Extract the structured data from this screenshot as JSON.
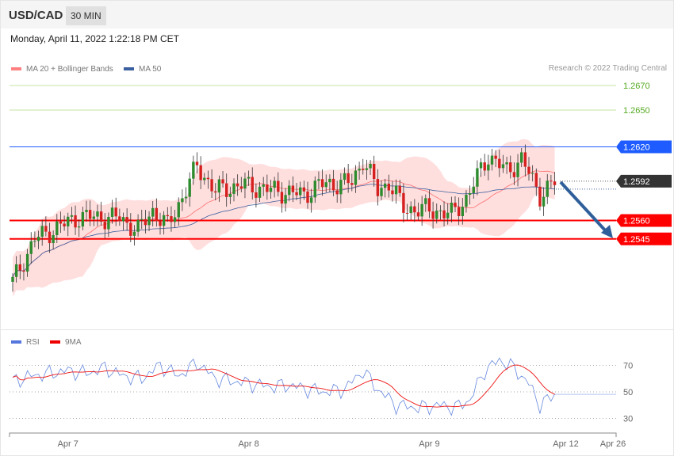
{
  "header": {
    "symbol": "USD/CAD",
    "timeframe": "30 MIN",
    "datetime": "Monday, April 11, 2022 1:22:18 PM CET"
  },
  "legend": {
    "ma20": "MA 20 + Bollinger Bands",
    "ma50": "MA 50",
    "rsi": "RSI",
    "ma9": "9MA",
    "copyright": "Research © 2022 Trading Central"
  },
  "colors": {
    "up": "#2e8b2e",
    "down": "#d62020",
    "band": "#ffdede",
    "ma20": "#ff7070",
    "ma50": "#3a5f9e",
    "resistance": "#1e5cff",
    "support": "#ff0000",
    "target": "#88cc44",
    "arrow": "#2f5f9a"
  },
  "chart_data": {
    "type": "candlestick",
    "ylim": [
      1.249,
      1.268
    ],
    "close_anchors": [
      [
        0,
        1.251
      ],
      [
        6,
        1.2545
      ],
      [
        18,
        1.2563
      ],
      [
        29,
        1.2562
      ],
      [
        34,
        1.2552
      ],
      [
        38,
        1.2568
      ],
      [
        42,
        1.2555
      ],
      [
        50,
        1.2604
      ],
      [
        55,
        1.2584
      ],
      [
        62,
        1.2589
      ],
      [
        70,
        1.2585
      ],
      [
        79,
        1.2581
      ],
      [
        83,
        1.2589
      ],
      [
        92,
        1.2591
      ],
      [
        95,
        1.261
      ],
      [
        99,
        1.2584
      ],
      [
        102,
        1.2591
      ],
      [
        106,
        1.257
      ],
      [
        115,
        1.2568
      ],
      [
        119,
        1.2565
      ],
      [
        123,
        1.2578
      ],
      [
        129,
        1.2613
      ],
      [
        134,
        1.26
      ],
      [
        138,
        1.261
      ],
      [
        143,
        1.2581
      ],
      [
        147,
        1.2591
      ]
    ],
    "candle_count": 148,
    "levels": [
      {
        "label": "1.2670",
        "value": 1.267,
        "type": "target"
      },
      {
        "label": "1.2650",
        "value": 1.265,
        "type": "target"
      },
      {
        "label": "1.2620",
        "value": 1.262,
        "type": "resistance"
      },
      {
        "label": "1.2592",
        "value": 1.2592,
        "type": "last"
      },
      {
        "label": "1.2560",
        "value": 1.256,
        "type": "support"
      },
      {
        "label": "1.2545",
        "value": 1.2545,
        "type": "support"
      }
    ],
    "rsi": {
      "ylim": [
        20,
        80
      ],
      "ticks": [
        "70",
        "50",
        "30"
      ],
      "tick_values": [
        70,
        50,
        30
      ],
      "anchors": [
        [
          0,
          58
        ],
        [
          5,
          62
        ],
        [
          10,
          64
        ],
        [
          15,
          66
        ],
        [
          20,
          64
        ],
        [
          25,
          68
        ],
        [
          30,
          62
        ],
        [
          35,
          60
        ],
        [
          40,
          70
        ],
        [
          45,
          62
        ],
        [
          50,
          72
        ],
        [
          55,
          60
        ],
        [
          60,
          58
        ],
        [
          65,
          56
        ],
        [
          70,
          54
        ],
        [
          75,
          55
        ],
        [
          80,
          52
        ],
        [
          85,
          50
        ],
        [
          90,
          52
        ],
        [
          95,
          66
        ],
        [
          99,
          52
        ],
        [
          104,
          40
        ],
        [
          110,
          38
        ],
        [
          116,
          40
        ],
        [
          120,
          38
        ],
        [
          124,
          44
        ],
        [
          128,
          66
        ],
        [
          132,
          74
        ],
        [
          136,
          68
        ],
        [
          140,
          56
        ],
        [
          143,
          40
        ],
        [
          147,
          48
        ]
      ]
    },
    "xticks": [
      "Apr 7",
      "Apr 8",
      "Apr 9",
      "Apr 12",
      "Apr 26"
    ],
    "xtick_index": [
      15,
      64,
      113,
      150,
      164
    ]
  }
}
